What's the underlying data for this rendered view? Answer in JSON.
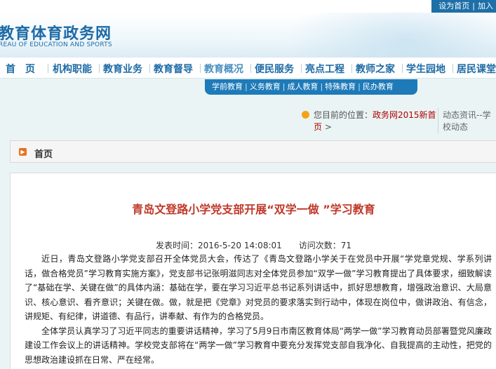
{
  "top_links": {
    "home": "设为首页",
    "sep": "|",
    "fav": "加入"
  },
  "site": {
    "title": "教育体育政务网",
    "subtitle": "REAU OF EDUCATION AND SPORTS"
  },
  "nav": [
    {
      "label": "首　页"
    },
    {
      "label": "机构职能"
    },
    {
      "label": "教育业务"
    },
    {
      "label": "教育督导"
    },
    {
      "label": "教育概况"
    },
    {
      "label": "便民服务"
    },
    {
      "label": "亮点工程"
    },
    {
      "label": "教师之家"
    },
    {
      "label": "学生园地"
    },
    {
      "label": "居民课堂"
    }
  ],
  "subnav": [
    {
      "label": "学前教育"
    },
    {
      "label": "义务教育"
    },
    {
      "label": "成人教育"
    },
    {
      "label": "特殊教育"
    },
    {
      "label": "民办教育"
    }
  ],
  "subnav_sep": "|",
  "breadcrumb": {
    "prefix": "您目前的位置：",
    "link": "政务网2015新首页",
    "arrow": ">",
    "right": "动态资讯--学校动态"
  },
  "home_bar": {
    "label": "首页",
    "icon": "arrow-right-icon"
  },
  "article": {
    "title": "青岛文登路小学党支部开展“双学一做 ”学习教育",
    "time_label": "发表时间：",
    "time_value": "2016-5-20 14:08:01",
    "visits_label": "访问次数：",
    "visits_value": "71",
    "paragraphs": [
      "近日，青岛文登路小学党支部召开全体党员大会，传达了《青岛文登路小学关于在党员中开展“学党章党规、学系列讲话，做合格党员”学习教育实施方案》，党支部书记张明滋同志对全体党员参加“双学一做”学习教育提出了具体要求，细致解读了“基础在学、关键在做”的具体内涵：基础在学，要在学习习近平总书记系列讲话中，抓好思想教育，增强政治意识、大局意识、核心意识、看齐意识；关键在做。做，就是把《党章》对党员的要求落实到行动中，体现在岗位中，做讲政治、有信念，讲规矩、有纪律，讲道德、有品行，讲奉献、有作为的合格党员。",
      "全体学员认真学习了习近平同志的重要讲话精神，学习了5月9日市南区教育体局“两学一做”学习教育动员部署暨党风廉政建设工作会议上的讲话精神。学校党支部将在“两学一做”学习教育中要充分发挥党支部自我净化、自我提高的主动性，把党的思想政治建设抓在日常、严在经常。"
    ]
  },
  "colors": {
    "brand_blue": "#1e6ba6",
    "subnav_blue": "#1e7ab8",
    "title_red": "#c0392b",
    "crumb_orange": "#f2a31b"
  }
}
